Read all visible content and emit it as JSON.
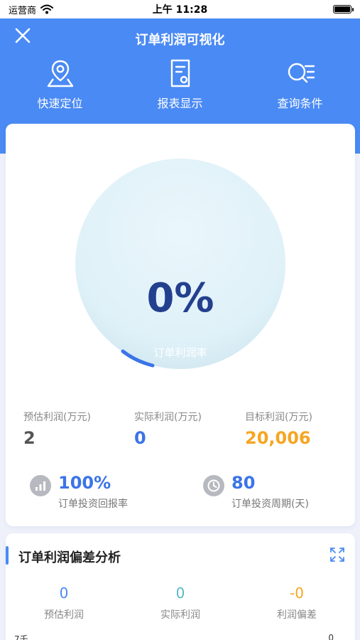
{
  "status": {
    "carrier": "运营商",
    "time": "上午 11:28"
  },
  "header": {
    "title": "订单利润可视化"
  },
  "toolbar": [
    {
      "label": "快速定位",
      "icon": "location-pin-icon"
    },
    {
      "label": "报表显示",
      "icon": "report-document-icon"
    },
    {
      "label": "查询条件",
      "icon": "search-list-icon"
    }
  ],
  "gauge": {
    "value": "0%",
    "label": "订单利润率",
    "progress": 0
  },
  "stats": [
    {
      "label": "预估利润(万元)",
      "value": "2",
      "color": "#555555"
    },
    {
      "label": "实际利润(万元)",
      "value": "0",
      "color": "#3b74e8"
    },
    {
      "label": "目标利润(万元)",
      "value": "20,006",
      "color": "#f5a623"
    }
  ],
  "kpis": [
    {
      "value": "100%",
      "label": "订单投资回报率",
      "icon": "bar-chart-icon"
    },
    {
      "value": "80",
      "label": "订单投资周期(天)",
      "icon": "clock-icon"
    }
  ],
  "deviation": {
    "title": "订单利润偏差分析",
    "items": [
      {
        "value": "0",
        "label": "预估利润",
        "color": "#4a8af4"
      },
      {
        "value": "0",
        "label": "实际利润",
        "color": "#5ab8c8"
      },
      {
        "value": "-0",
        "label": "利润偏差",
        "color": "#f5a623"
      }
    ],
    "axis_left": "7千",
    "axis_right": "0"
  },
  "colors": {
    "primary": "#4a8af4",
    "background": "#eef1fa"
  }
}
